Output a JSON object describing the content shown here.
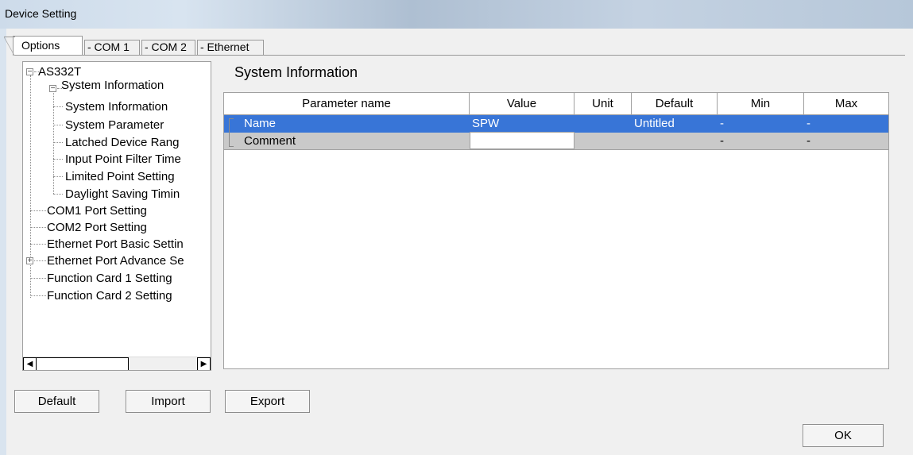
{
  "window": {
    "title": "Device Setting"
  },
  "tabs": [
    {
      "label": "Options"
    },
    {
      "label": "- COM 1"
    },
    {
      "label": "- COM 2"
    },
    {
      "label": "- Ethernet"
    }
  ],
  "tree": {
    "root": "AS332T",
    "items": [
      {
        "label": "System Information"
      },
      {
        "label": "System Information"
      },
      {
        "label": "System Parameter"
      },
      {
        "label": "Latched Device Rang"
      },
      {
        "label": "Input Point Filter Time"
      },
      {
        "label": "Limited Point Setting"
      },
      {
        "label": "Daylight Saving Timin"
      },
      {
        "label": "COM1 Port Setting"
      },
      {
        "label": "COM2 Port Setting"
      },
      {
        "label": "Ethernet Port Basic Settin"
      },
      {
        "label": "Ethernet Port Advance Se"
      },
      {
        "label": "Function Card 1 Setting"
      },
      {
        "label": "Function Card 2 Setting"
      }
    ]
  },
  "main": {
    "section_title": "System Information",
    "columns": [
      "Parameter name",
      "Value",
      "Unit",
      "Default",
      "Min",
      "Max"
    ],
    "rows": [
      {
        "name": "Name",
        "value": "SPW",
        "unit": "",
        "default": "Untitled",
        "min": "-",
        "max": "-"
      },
      {
        "name": "Comment",
        "value": "",
        "unit": "",
        "default": "",
        "min": "-",
        "max": "-"
      }
    ]
  },
  "buttons": {
    "default": "Default",
    "import": "Import",
    "export": "Export",
    "ok": "OK"
  },
  "colors": {
    "selection": "#3875d7",
    "row_gray": "#c9c9c9"
  }
}
